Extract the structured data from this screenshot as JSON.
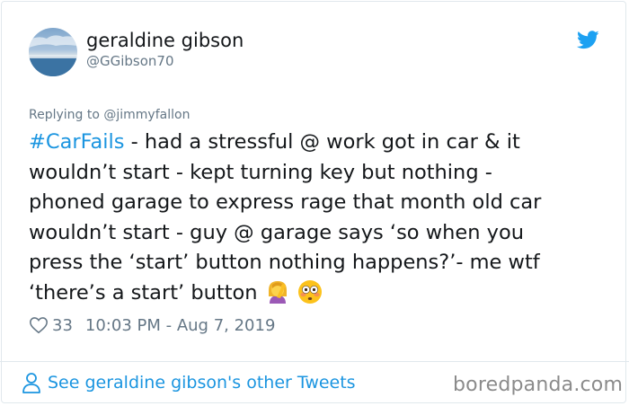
{
  "author": {
    "display_name": "geraldine gibson",
    "handle": "@GGibson70"
  },
  "reply_to": "Replying to @jimmyfallon",
  "tweet": {
    "hashtag": "#CarFails",
    "lines": [
      " - had a stressful @ work got in car & it",
      "wouldn’t start - kept turning key but nothing -",
      "phoned garage to express rage that month old car",
      "wouldn’t start - guy @ garage says ‘so when you",
      "press the ‘start’ button nothing happens?’- me wtf",
      "‘there’s a start’ button"
    ],
    "emojis": [
      "woman-facepalming-emoji",
      "flushed-face-emoji"
    ]
  },
  "meta": {
    "likes": "33",
    "timestamp": "10:03 PM - Aug 7, 2019"
  },
  "footer": {
    "see_more": "See geraldine gibson's other Tweets",
    "brand": "boredpanda.com"
  },
  "colors": {
    "link": "#1b95e0",
    "secondary_text": "#657786",
    "border": "#e1e8ed"
  }
}
